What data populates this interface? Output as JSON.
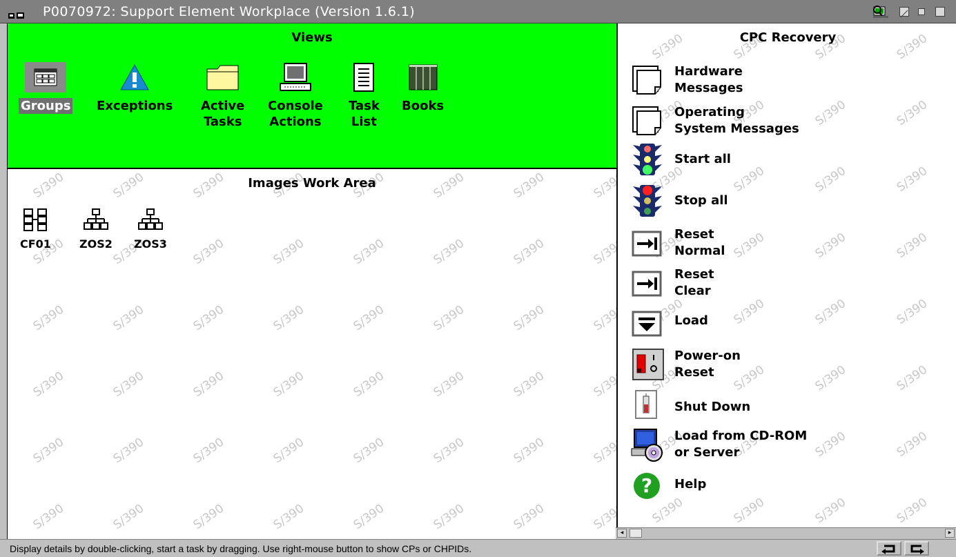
{
  "window": {
    "title": "P0070972: Support Element Workplace (Version 1.6.1)"
  },
  "views": {
    "title": "Views",
    "items": [
      {
        "label_lines": [
          "Groups"
        ],
        "icon": "groups-icon",
        "selected": true
      },
      {
        "label_lines": [
          "Exceptions"
        ],
        "icon": "exceptions-icon",
        "selected": false
      },
      {
        "label_lines": [
          "Active",
          "Tasks"
        ],
        "icon": "folder-icon",
        "selected": false
      },
      {
        "label_lines": [
          "Console",
          "Actions"
        ],
        "icon": "console-icon",
        "selected": false
      },
      {
        "label_lines": [
          "Task",
          "List"
        ],
        "icon": "task-list-icon",
        "selected": false
      },
      {
        "label_lines": [
          "Books"
        ],
        "icon": "books-icon",
        "selected": false
      }
    ]
  },
  "work_area": {
    "title": "Images Work Area",
    "watermark": "S/390",
    "images": [
      {
        "label": "CF01",
        "icon": "coupling-facility-icon"
      },
      {
        "label": "ZOS2",
        "icon": "partition-hierarchy-icon"
      },
      {
        "label": "ZOS3",
        "icon": "partition-hierarchy-icon"
      }
    ]
  },
  "cpc_recovery": {
    "title": "CPC Recovery",
    "tasks": [
      {
        "label_lines": [
          "Hardware",
          "Messages"
        ],
        "icon": "document-stack-icon"
      },
      {
        "label_lines": [
          "Operating",
          "System Messages"
        ],
        "icon": "document-stack-icon"
      },
      {
        "label_lines": [
          "Start all"
        ],
        "icon": "traffic-light-green-icon"
      },
      {
        "label_lines": [
          "Stop all"
        ],
        "icon": "traffic-light-red-icon"
      },
      {
        "label_lines": [
          "Reset",
          "Normal"
        ],
        "icon": "reset-arrow-icon"
      },
      {
        "label_lines": [
          "Reset",
          "Clear"
        ],
        "icon": "reset-arrow-icon"
      },
      {
        "label_lines": [
          "Load"
        ],
        "icon": "load-arrow-icon"
      },
      {
        "label_lines": [
          "Power-on",
          "Reset"
        ],
        "icon": "power-switch-icon"
      },
      {
        "label_lines": [
          "Shut Down"
        ],
        "icon": "shutdown-switch-icon"
      },
      {
        "label_lines": [
          "Load from CD-ROM",
          "or Server"
        ],
        "icon": "cd-computer-icon"
      },
      {
        "label_lines": [
          "Help"
        ],
        "icon": "help-icon"
      }
    ]
  },
  "status_bar": {
    "text": "Display details by double-clicking, start a task by dragging. Use right-mouse button to show CPs or CHPIDs."
  },
  "colors": {
    "views_background": "#00ff00",
    "title_bar": "#808080",
    "selected_label": "#707070",
    "watermark": "#c8c8c8"
  }
}
